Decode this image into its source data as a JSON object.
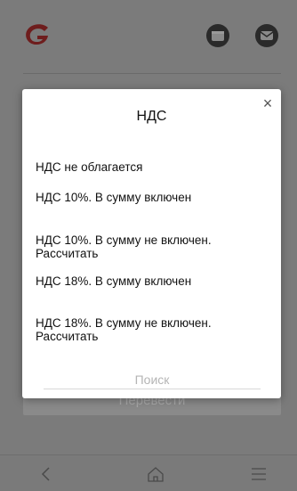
{
  "modal": {
    "title": "НДС",
    "close_label": "×",
    "options": [
      "НДС не облагается",
      "НДС 10%. В сумму включен",
      "НДС 10%. В сумму не включен. Рассчитать",
      "НДС 18%. В сумму включен",
      "НДС 18%. В сумму не включен. Рассчитать"
    ],
    "search_placeholder": "Поиск"
  },
  "background": {
    "button_label": "Перевести"
  },
  "icons": {
    "logo": "logo-icon",
    "calendar": "calendar-icon",
    "mail": "mail-icon",
    "back": "chevron-left-icon",
    "home": "home-icon",
    "menu": "menu-icon"
  },
  "colors": {
    "logo": "#c42b2b",
    "overlay": "#7b7b7b",
    "modal_bg": "#ffffff"
  }
}
